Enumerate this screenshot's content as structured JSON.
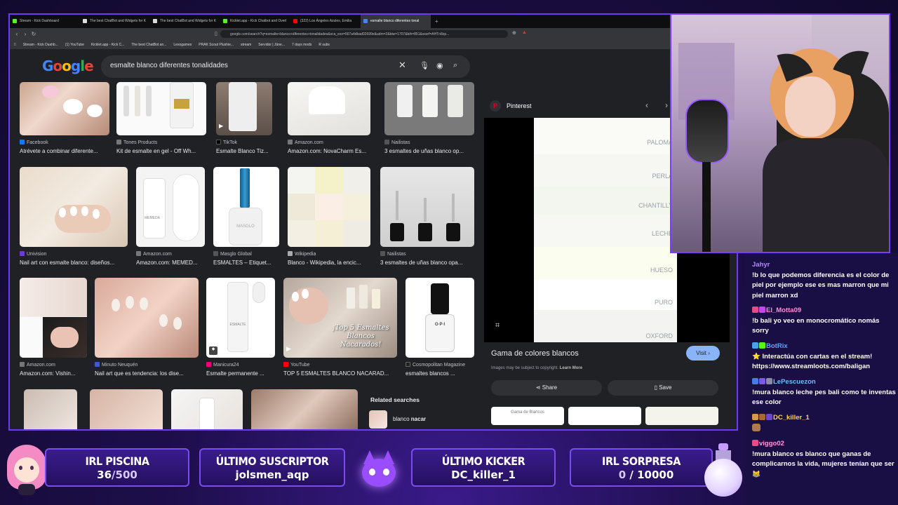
{
  "browser": {
    "tabs": [
      {
        "label": "Stream - Kick Dashboard",
        "color": "#53fc18"
      },
      {
        "label": "The best ChatBot and Widgets for K",
        "color": "#fff"
      },
      {
        "label": "The best ChatBot and Widgets for K",
        "color": "#fff"
      },
      {
        "label": "Kicklet.app - Kick Chatbot and Overl",
        "color": "#53fc18"
      },
      {
        "label": "(322) Los Ángeles Azules, Emilia",
        "color": "#ff0000"
      },
      {
        "label": "esmalte blanco diferentes tonal",
        "color": "#4285f4"
      }
    ],
    "url": "google.com/search?q=esmalte+blanco+diferentes+tonalidades&sca_esv=567a4dbad02699e&udm=2&biw=1707&bih=851&sxsrf=AHTn8zp...",
    "bookmarks": [
      "Stream - Kick Dashb...",
      "(1) YouTube",
      "Kicklet.app - Kick C...",
      "The best ChatBot an...",
      "Lexogames",
      "PRAK Scout Plushie...",
      "stream",
      "Servidor | Jüne...",
      "7 days mods",
      "R subs"
    ]
  },
  "google": {
    "logo": "Google",
    "query": "esmalte blanco diferentes tonalidades",
    "results": [
      {
        "source": "Facebook",
        "title": "Atrévete a combinar diferente...",
        "color": "#1877f2"
      },
      {
        "source": "Tones Products",
        "title": "Kit de esmalte en gel - Off Wh...",
        "color": "#777"
      },
      {
        "source": "TikTok",
        "title": "Esmalte Blanco Tiz...",
        "color": "#000"
      },
      {
        "source": "Amazon.com",
        "title": "Amazon.com: NovaCharm Es...",
        "color": "#777"
      },
      {
        "source": "Nailistas",
        "title": "3 esmaltes de uñas blanco op...",
        "color": "#555"
      },
      {
        "source": "Univision",
        "title": "Nail art con esmalte blanco: diseños...",
        "color": "#6c3bd6"
      },
      {
        "source": "Amazon.com",
        "title": "Amazon.com: MEMED...",
        "color": "#777"
      },
      {
        "source": "Masglo Global",
        "title": "ESMALTES – Etiquet...",
        "color": "#555"
      },
      {
        "source": "Wikipedia",
        "title": "Blanco - Wikipedia, la encic...",
        "color": "#aaa"
      },
      {
        "source": "Nailistas",
        "title": "3 esmaltes de uñas blanco opa...",
        "color": "#555"
      },
      {
        "source": "Amazon.com",
        "title": "Amazon.com: Vishin...",
        "color": "#777"
      },
      {
        "source": "Minuto Neuquén",
        "title": "Nail art que es tendencia: los dise...",
        "color": "#3b5bd6"
      },
      {
        "source": "Manicura24",
        "title": "Esmalte permanente ...",
        "color": "#e07"
      },
      {
        "source": "YouTube",
        "title": "TOP 5 ESMALTES BLANCO NACARAD...",
        "color": "#ff0000"
      },
      {
        "source": "Cosmopolitan Magazine",
        "title": "esmaltes blancos ...",
        "color": "#222"
      }
    ],
    "thumb_texts": [
      "¡Top 5 Esmaltes Blancos Nacarados!",
      "MASGLO",
      "ESMALTE",
      "O·P·I",
      "MEMEDA"
    ],
    "related": {
      "heading": "Related searches",
      "item_prefix": "blanco ",
      "item_bold": "nacar"
    },
    "panel": {
      "site": "Pinterest",
      "swatches": [
        "PALOMA",
        "PERLA",
        "CHANTILLY",
        "LECHE",
        "HUESO",
        "PURO",
        "OXFORD"
      ],
      "title": "Gama de colores blancos",
      "visit": "Visit",
      "copyright": "Images may be subject to copyright.",
      "learn_more": "Learn More",
      "share": "Share",
      "save": "Save",
      "thumb_label": "Gama de Blancos"
    }
  },
  "chat": [
    {
      "user": "Jahyr",
      "color": "#b388ff",
      "text": "!b lo que podemos diferencia es el color de piel por ejemplo ese es mas marron que mi piel marron xd"
    },
    {
      "user": "El_Motta09",
      "color": "#ff8ad8",
      "text": "!b bali yo veo en monocromático nomás sorry"
    },
    {
      "user": "BotRix",
      "color": "#58a6ff",
      "text": "⭐ Interactúa con cartas en el stream! https://www.streamloots.com/baligan"
    },
    {
      "user": "LePescuezon",
      "color": "#7ab6ff",
      "text": "!mura blanco leche pes bali como te inventas ese color"
    },
    {
      "user": "DC_killer_1",
      "color": "#ffd24a",
      "text": ""
    },
    {
      "user": "viggo02",
      "color": "#ff9de2",
      "text": "!mura blanco es blanco que ganas de complicarnos la vida, mujeres tenían que ser 😹"
    }
  ],
  "overlay": {
    "stats": [
      {
        "title": "IRL PISCINA",
        "value": "36",
        "value_suffix": "/500"
      },
      {
        "title": "ÚLTIMO SUSCRIPTOR",
        "value": "jolsmen_aqp",
        "value_suffix": ""
      },
      {
        "title": "ÚLTIMO KICKER",
        "value": "DC_killer_1",
        "value_suffix": ""
      },
      {
        "title": "IRL SORPRESA",
        "value": "0",
        "value_suffix": " / 10000"
      }
    ],
    "accent": "#7a3cff"
  }
}
